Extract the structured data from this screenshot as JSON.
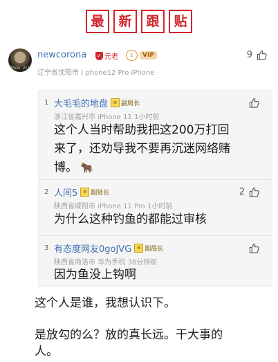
{
  "header": {
    "title_chars": [
      "最",
      "新",
      "跟",
      "贴"
    ]
  },
  "main_post": {
    "avatar_text": "Thom 2li",
    "username": "newcorona",
    "badge": "元老",
    "vip_label": "VIP",
    "location": "辽宁省沈阳市",
    "device": "I phone12 Pro iPhone",
    "likes": "9"
  },
  "quotes": [
    {
      "num": "1",
      "name": "大毛毛的地盘",
      "rank": "副局长",
      "location": "浙江省嘉兴市",
      "device": "iPhone 11",
      "time": "1小时前",
      "text_lines": [
        "这个人当时帮助我把这200万打回",
        "来了，还劝导我不要再沉迷网络赌",
        "博。"
      ],
      "emoji": "🐂",
      "likes": ""
    },
    {
      "num": "2",
      "name": "人间5",
      "rank": "副处长",
      "location": "陕西省咸阳市",
      "device": "iPhone 11 Pro",
      "time": "1小时前",
      "text_lines": [
        "为什么这种钓鱼的都能过审核"
      ],
      "likes": "2"
    },
    {
      "num": "3",
      "name": "有态度网友0goJVG",
      "rank": "副局长",
      "location": "陕西省商洛市",
      "device": "华为手机",
      "time": "38分钟前",
      "text_lines": [
        "因为鱼没上钩啊"
      ],
      "likes": ""
    }
  ],
  "comments": [
    "这个人是谁，我想认识下。",
    "是放勾的么？放的真长远。干大事的",
    "人。"
  ],
  "colors": {
    "accent_red": "#d0262d",
    "link_blue": "#3e6fb4"
  }
}
